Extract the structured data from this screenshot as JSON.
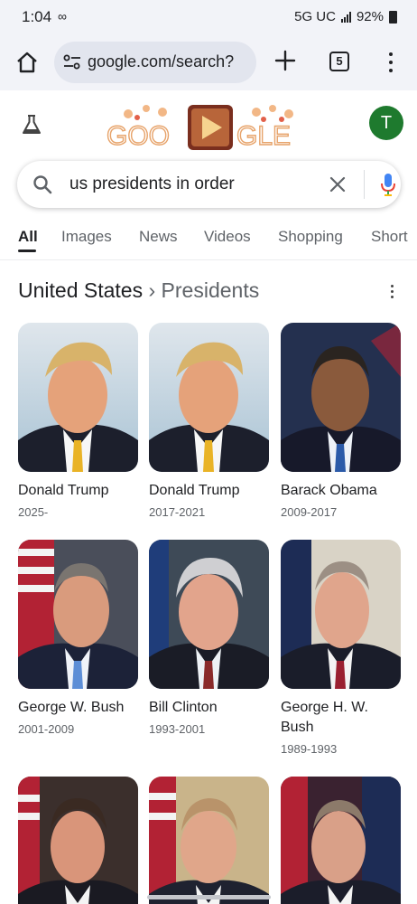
{
  "status_bar": {
    "time": "1:04",
    "left_icons": "∞ ",
    "network": "5G UC",
    "battery": "92%"
  },
  "browser": {
    "url": "google.com/search?",
    "tab_count": "5",
    "icons": [
      "home-icon",
      "site-settings-icon",
      "new-tab-plus-icon",
      "tab-switcher-icon",
      "more-menu-icon"
    ]
  },
  "google": {
    "doodle_text": "GOOGLE",
    "avatar_letter": "T",
    "avatar_color": "#1e7a2e"
  },
  "search": {
    "query": "us presidents in order"
  },
  "tabs": [
    "All",
    "Images",
    "News",
    "Videos",
    "Shopping",
    "Short"
  ],
  "knowledge": {
    "entity": "United States",
    "separator": "›",
    "category": "Presidents"
  },
  "presidents": [
    {
      "name": "Donald Trump",
      "years": "2025-"
    },
    {
      "name": "Donald Trump",
      "years": "2017-2021"
    },
    {
      "name": "Barack Obama",
      "years": "2009-2017"
    },
    {
      "name": "George W. Bush",
      "years": "2001-2009"
    },
    {
      "name": "Bill Clinton",
      "years": "1993-2001"
    },
    {
      "name": "George H. W. Bush",
      "years": "1989-1993"
    },
    {
      "name": "",
      "years": ""
    },
    {
      "name": "",
      "years": ""
    },
    {
      "name": "",
      "years": ""
    }
  ]
}
